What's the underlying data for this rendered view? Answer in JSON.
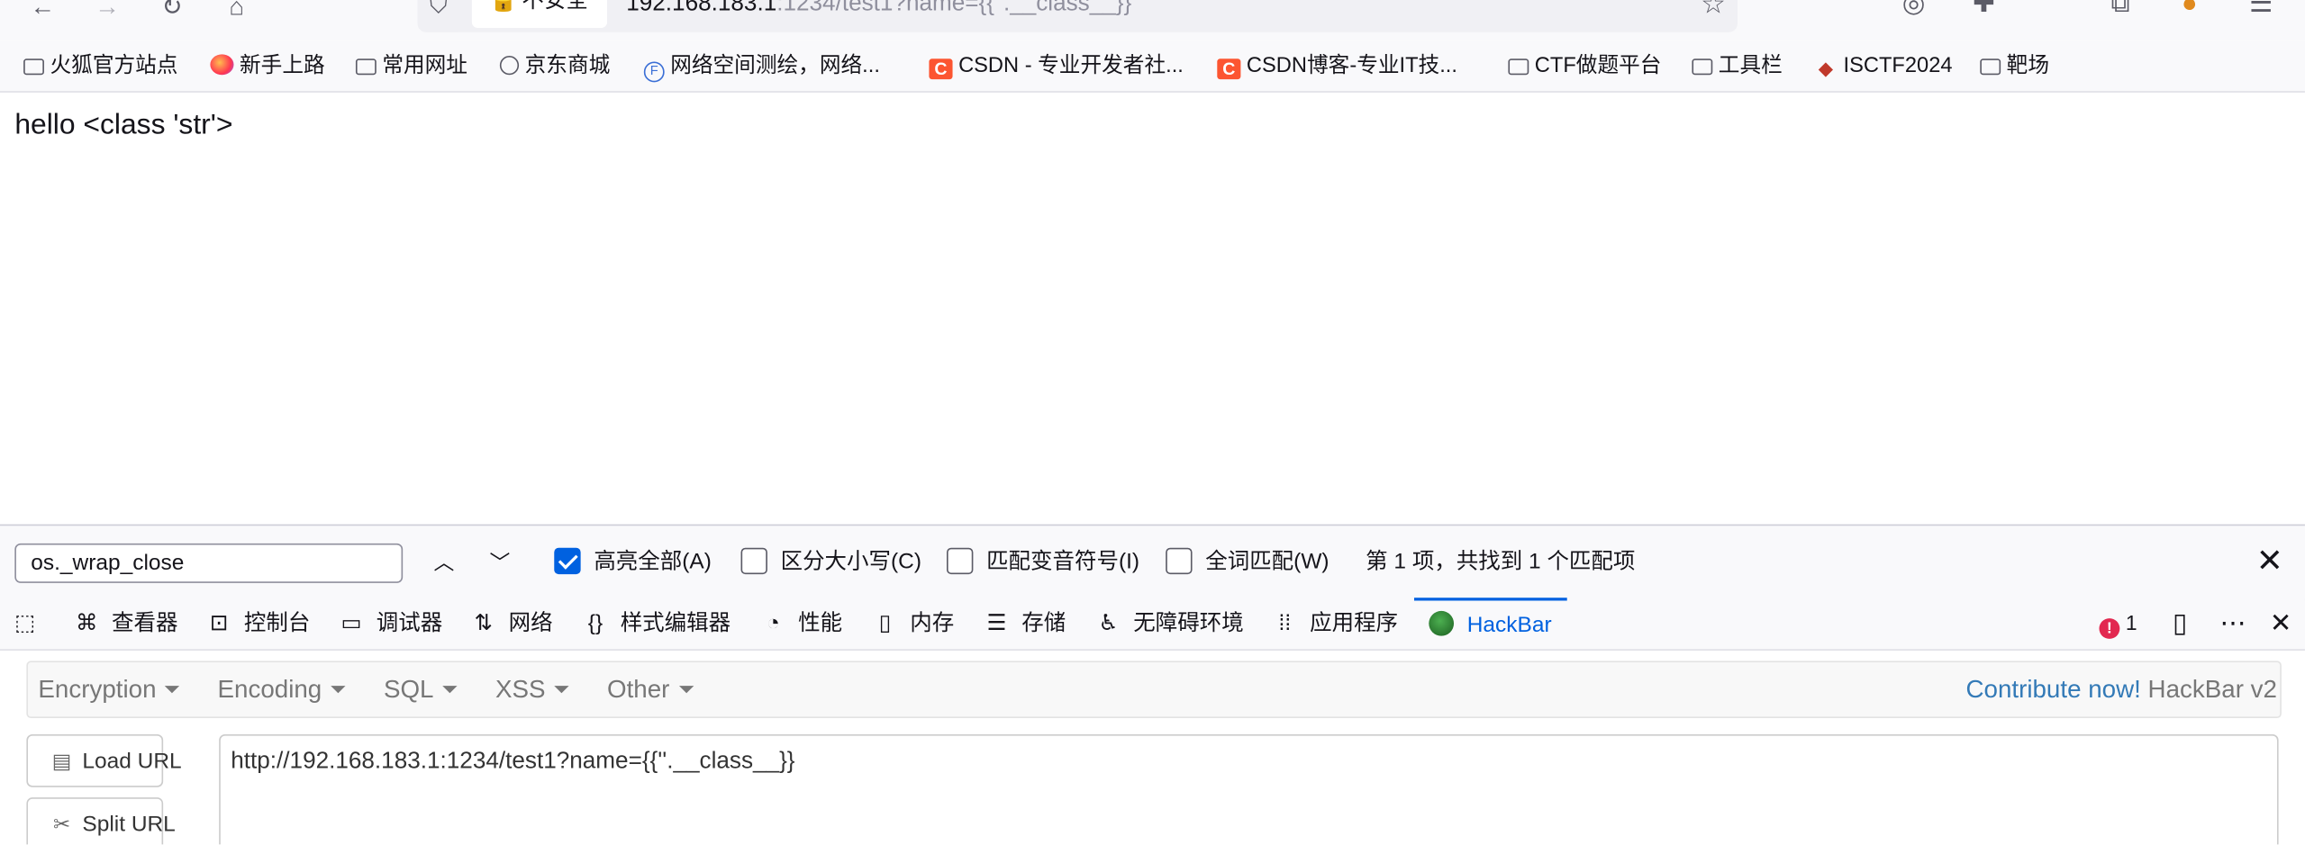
{
  "browser": {
    "security_label": "不安全",
    "url_host": "192.168.183.1",
    "url_rest": ":1234/test1?name={{''.__class__}}",
    "icons": [
      "back-arrow-icon",
      "forward-arrow-icon",
      "reload-icon",
      "home-icon",
      "shield-icon",
      "lock-broken-icon",
      "star-icon",
      "account-icon",
      "extensions-icon",
      "open-tab-icon",
      "fox-avatar-icon",
      "menu-icon"
    ]
  },
  "bookmarks": [
    {
      "label": "火狐官方站点",
      "icon": "folder-icon"
    },
    {
      "label": "新手上路",
      "icon": "firefox-icon"
    },
    {
      "label": "常用网址",
      "icon": "folder-icon"
    },
    {
      "label": "京东商城",
      "icon": "globe-icon"
    },
    {
      "label": "网络空间测绘，网络...",
      "icon": "fofa-icon"
    },
    {
      "label": "CSDN - 专业开发者社...",
      "icon": "csdn-icon"
    },
    {
      "label": "CSDN博客-专业IT技...",
      "icon": "csdn-icon"
    },
    {
      "label": "CTF做题平台",
      "icon": "folder-icon"
    },
    {
      "label": "工具栏",
      "icon": "folder-icon"
    },
    {
      "label": "ISCTF2024",
      "icon": "isctf-icon"
    },
    {
      "label": "靶场",
      "icon": "folder-icon"
    }
  ],
  "page": {
    "content": "hello <class 'str'>"
  },
  "findbar": {
    "query": "os._wrap_close",
    "options": [
      {
        "label": "高亮全部(A)",
        "checked": true
      },
      {
        "label": "区分大小写(C)",
        "checked": false
      },
      {
        "label": "匹配变音符号(I)",
        "checked": false
      },
      {
        "label": "全词匹配(W)",
        "checked": false
      }
    ],
    "status": "第 1 项，共找到 1 个匹配项"
  },
  "devtools": {
    "tabs": [
      {
        "label": "查看器",
        "icon": "inspector-icon"
      },
      {
        "label": "控制台",
        "icon": "console-icon"
      },
      {
        "label": "调试器",
        "icon": "debugger-icon"
      },
      {
        "label": "网络",
        "icon": "network-icon"
      },
      {
        "label": "样式编辑器",
        "icon": "style-editor-icon"
      },
      {
        "label": "性能",
        "icon": "performance-icon"
      },
      {
        "label": "内存",
        "icon": "memory-icon"
      },
      {
        "label": "存储",
        "icon": "storage-icon"
      },
      {
        "label": "无障碍环境",
        "icon": "accessibility-icon"
      },
      {
        "label": "应用程序",
        "icon": "application-icon"
      },
      {
        "label": "HackBar",
        "icon": "hackbar-icon",
        "active": true
      }
    ],
    "error_count": "1"
  },
  "hackbar": {
    "menus": [
      "Encryption",
      "Encoding",
      "SQL",
      "XSS",
      "Other"
    ],
    "contribute_link": "Contribute now!",
    "version": "HackBar v2",
    "load_url": "Load URL",
    "split_url": "Split URL",
    "url_value": "http://192.168.183.1:1234/test1?name={{''.__class__}}"
  },
  "colors": {
    "accent": "#0061e0",
    "error": "#e22850",
    "link": "#337ab7"
  }
}
